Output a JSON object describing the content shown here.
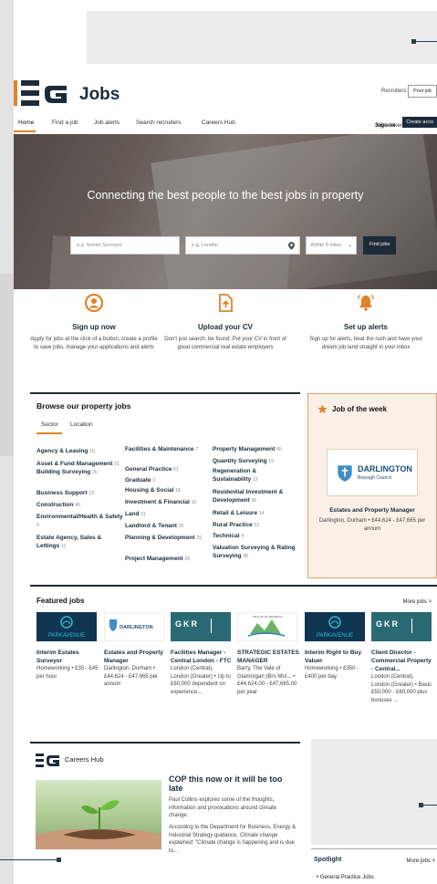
{
  "brand": {
    "logo_text": "EG",
    "name": "Jobs",
    "accent_color": "#e0812b",
    "navy_color": "#1d2b3a"
  },
  "header": {
    "recruiters_label": "Recruiters:",
    "post_job_label": "Post job"
  },
  "nav": {
    "items": [
      "Home",
      "Find a job",
      "Job alerts",
      "Search recruiters",
      "Careers Hub"
    ],
    "active": "Home",
    "jobseekers_label": "Jobseekers",
    "sign_in_label": "Sign in",
    "create_account_label": "Create acco"
  },
  "hero": {
    "title": "Connecting the best people to the best jobs in property",
    "keyword_placeholder": "e.g. Senior Surveyor",
    "location_placeholder": "e.g. London",
    "radius_value": "Within 5 miles",
    "find_button": "Find jobs"
  },
  "features": [
    {
      "icon": "user-icon",
      "title": "Sign up now",
      "desc": "Apply for jobs at the click of a button, create a profile to save jobs, manage your applications and alerts"
    },
    {
      "icon": "upload-icon",
      "title": "Upload your CV",
      "desc": "Don't just search, be found: Put your CV in front of great commercial real estate employers"
    },
    {
      "icon": "bell-icon",
      "title": "Set up alerts",
      "desc": "Sign up for alerts, beat the rush and have your dream job land straight in your inbox"
    }
  ],
  "browse": {
    "title": "Browse our property jobs",
    "tabs": [
      "Sector",
      "Location"
    ],
    "active_tab": "Sector",
    "col1": [
      {
        "name": "Agency & Leasing",
        "count": "19"
      },
      {
        "name": "Asset & Fund Management",
        "count": "31"
      },
      {
        "name": "Building Surveying",
        "count": "26"
      },
      {
        "name": "Business Support",
        "count": "13"
      },
      {
        "name": "Construction",
        "count": "40"
      },
      {
        "name": "Environmental/Health & Safety",
        "count": "4"
      },
      {
        "name": "Estate Agency, Sales & Lettings",
        "count": "11"
      }
    ],
    "col2": [
      {
        "name": "Facilities & Maintenance",
        "count": "7"
      },
      {
        "name": "General Practice",
        "count": "51"
      },
      {
        "name": "Graduate",
        "count": "2"
      },
      {
        "name": "Housing & Social",
        "count": "18"
      },
      {
        "name": "Investment & Financial",
        "count": "16"
      },
      {
        "name": "Land",
        "count": "11"
      },
      {
        "name": "Landlord & Tenant",
        "count": "26"
      },
      {
        "name": "Planning & Development",
        "count": "29"
      },
      {
        "name": "Project Management",
        "count": "29"
      }
    ],
    "col3": [
      {
        "name": "Property Management",
        "count": "45"
      },
      {
        "name": "Quantity Surveying",
        "count": "15"
      },
      {
        "name": "Regeneration & Sustainability",
        "count": "12"
      },
      {
        "name": "Residential Investment & Development",
        "count": "35"
      },
      {
        "name": "Retail & Leisure",
        "count": "14"
      },
      {
        "name": "Rural Practice",
        "count": "12"
      },
      {
        "name": "Technical",
        "count": "4"
      },
      {
        "name": "Valuation Surveying & Rating Surveying",
        "count": "38"
      }
    ]
  },
  "job_of_week": {
    "title": "Job of the week",
    "logo_name": "DARLINGTON",
    "logo_sub": "Borough Council",
    "job_title": "Estates and Property Manager",
    "job_desc": "Darlington, Durham • £44,624 - £47,665 per annum"
  },
  "featured": {
    "title": "Featured jobs",
    "more_label": "More jobs >",
    "jobs": [
      {
        "logo": "PARKAVENUE",
        "title": "Interim Estates Surveyor",
        "desc": "Homeworking • £35 - £45 per hour"
      },
      {
        "logo": "DARLINGTON",
        "title": "Estates and Property Manager",
        "desc": "Darlington, Durham • £44,624 - £47,665 per annum"
      },
      {
        "logo": "GKR",
        "title": "Facilities Manager - Central London - FTC",
        "desc": "London (Central), London (Greater) • Up to £60,000 dependent on experience..."
      },
      {
        "logo": "VALE OF GLAMORGAN",
        "title": "STRATEGIC ESTATES MANAGER",
        "desc": "Barry, The Vale of Glamorgan (Bro Mor... • £44,624.00 - £47,665.00 per year"
      },
      {
        "logo": "PARKAVENUE",
        "title": "Interim Right to Buy Valuer",
        "desc": "Homeworking • £350 - £400 per day"
      },
      {
        "logo": "GKR",
        "title": "Client Director - Commercial Property - Central...",
        "desc": "London (Central), London (Greater) • Basic £50,000 - £60,000 plus bonuses ..."
      }
    ]
  },
  "careers": {
    "title": "Careers Hub",
    "article_title": "COP this now or it will be too late",
    "p1": "Paul Collins explores some of the thoughts, information and provocations around climate change.",
    "p2_a": "According to the Department for Business, Energy & Industrial Strategy guidance, ",
    "p2_em": "Climate change explained",
    "p2_b": ": \"Climate change is happening and is due to..."
  },
  "spotlight": {
    "title": "Spotlight",
    "more_label": "More jobs >",
    "item": "General Practice Jobs"
  }
}
